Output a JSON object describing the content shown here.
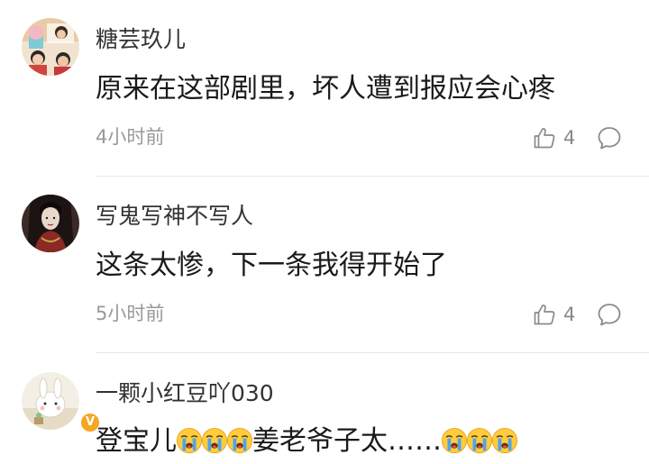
{
  "comments": [
    {
      "username": "糖芸玖儿",
      "content": "原来在这部剧里，坏人遭到报应会心疼",
      "time": "4小时前",
      "likes": "4"
    },
    {
      "username": "写鬼写神不写人",
      "content": "这条太惨，下一条我得开始了",
      "time": "5小时前",
      "likes": "4"
    },
    {
      "username": "一颗小红豆吖030",
      "content_part1": "登宝儿",
      "content_part2": "姜老爷子太……",
      "verified_badge": "V"
    }
  ],
  "icons": {
    "like": "thumbs-up-icon",
    "reply": "comment-bubble-icon",
    "emoji": "crying-face-emoji"
  },
  "colors": {
    "username": "#333333",
    "content": "#1a1a1a",
    "meta": "#999999",
    "badge": "#f5a623"
  }
}
